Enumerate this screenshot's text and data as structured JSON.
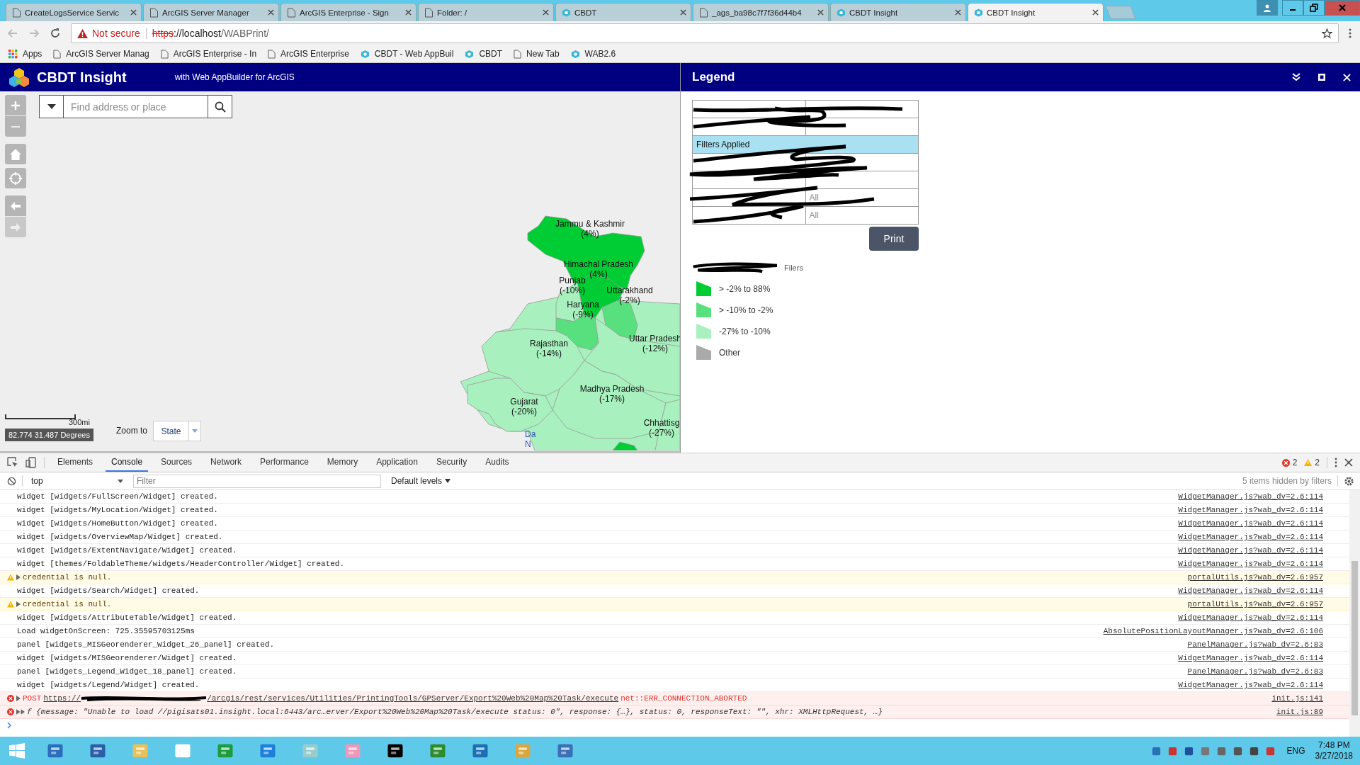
{
  "browser": {
    "tabs": [
      {
        "title": "CreateLogsService Servic",
        "kind": "page",
        "selected": false
      },
      {
        "title": "ArcGIS Server Manager",
        "kind": "page",
        "selected": false
      },
      {
        "title": "ArcGIS Enterprise - Sign",
        "kind": "page",
        "selected": false
      },
      {
        "title": "Folder: /",
        "kind": "page",
        "selected": false
      },
      {
        "title": "CBDT",
        "kind": "app",
        "selected": false
      },
      {
        "title": "_ags_ba98c7f7f36d44b4",
        "kind": "page",
        "selected": false
      },
      {
        "title": "CBDT Insight",
        "kind": "app",
        "selected": false
      },
      {
        "title": "CBDT Insight",
        "kind": "app",
        "selected": true
      }
    ],
    "security": "Not secure",
    "url_scheme": "https",
    "url_host": "://localhost",
    "url_path": "/WABPrint/",
    "bookmarks": [
      {
        "label": "Apps",
        "kind": "apps"
      },
      {
        "label": "ArcGIS Server Manag",
        "kind": "page"
      },
      {
        "label": "ArcGIS Enterprise - In",
        "kind": "page"
      },
      {
        "label": "ArcGIS Enterprise",
        "kind": "page"
      },
      {
        "label": "CBDT - Web AppBuil",
        "kind": "app"
      },
      {
        "label": "CBDT",
        "kind": "app"
      },
      {
        "label": "New Tab",
        "kind": "page"
      },
      {
        "label": "WAB2.6",
        "kind": "app"
      }
    ]
  },
  "app": {
    "title": "CBDT Insight",
    "subtitle": "with Web AppBuilder for ArcGIS",
    "search": {
      "placeholder": "Find address or place"
    },
    "scale": "300mi",
    "coordinates": "82.774 31.487 Degrees",
    "zoom_to_label": "Zoom to",
    "zoom_to_value": "State",
    "regions": [
      {
        "color": "#a8f0be"
      },
      {
        "color": "#00cc33",
        "label": "Jammu & Kashmir",
        "value": "(4%)"
      },
      {
        "color": "#00cc33",
        "label": "Himachal Pradesh",
        "value": "(4%)"
      },
      {
        "color": "#a8f0be",
        "label": "Punjab",
        "value": "(-10%)"
      },
      {
        "color": "#58e07f",
        "label": "Uttarakhand",
        "value": "(-2%)"
      },
      {
        "color": "#58e07f",
        "label": "Haryana",
        "value": "(-9%)"
      },
      {
        "color": "#a8f0be",
        "label": "Rajasthan",
        "value": "(-14%)"
      },
      {
        "color": "#a8f0be",
        "label": "Uttar Pradesh",
        "value": "(-12%)"
      },
      {
        "color": "#a8f0be",
        "label": "Madhya Pradesh",
        "value": "(-17%)"
      },
      {
        "color": "#a8f0be",
        "label": "Gujarat",
        "value": "(-20%)"
      },
      {
        "color": "#a8f0be",
        "label": "Chhattisg",
        "value": "(-27%)"
      },
      {
        "color": "#00cc33"
      }
    ],
    "map_labels": [
      "Da",
      "N"
    ]
  },
  "legend": {
    "title": "Legend",
    "table": [
      {
        "kind": "redacted"
      },
      {
        "kind": "redacted"
      },
      {
        "kind": "header",
        "label": "Filters Applied"
      },
      {
        "kind": "redacted"
      },
      {
        "kind": "redacted"
      },
      {
        "kind": "row",
        "value": "All"
      },
      {
        "kind": "row",
        "value": "All"
      }
    ],
    "print_button": "Print",
    "layer_title": "Filers",
    "classes": [
      {
        "label": "> -2% to 88%",
        "color": "#00cc33"
      },
      {
        "label": "> -10% to -2%",
        "color": "#58e07f"
      },
      {
        "label": "-27% to -10%",
        "color": "#a8f0be"
      },
      {
        "label": "Other",
        "color": "#aaaaaa"
      }
    ]
  },
  "devtools": {
    "tabs": [
      {
        "label": "Elements",
        "selected": false
      },
      {
        "label": "Console",
        "selected": true
      },
      {
        "label": "Sources",
        "selected": false
      },
      {
        "label": "Network",
        "selected": false
      },
      {
        "label": "Performance",
        "selected": false
      },
      {
        "label": "Memory",
        "selected": false
      },
      {
        "label": "Application",
        "selected": false
      },
      {
        "label": "Security",
        "selected": false
      },
      {
        "label": "Audits",
        "selected": false
      }
    ],
    "error_count": "2",
    "warning_count": "2",
    "context": "top",
    "filter": {
      "placeholder": "Filter"
    },
    "levels": "Default levels",
    "hidden_note": "5 items hidden by filters",
    "messages": [
      {
        "kind": "log",
        "text": "widget [widgets/FullScreen/Widget] created.",
        "source": "WidgetManager.js?wab_dv=2.6:114"
      },
      {
        "kind": "log",
        "text": "widget [widgets/MyLocation/Widget] created.",
        "source": "WidgetManager.js?wab_dv=2.6:114"
      },
      {
        "kind": "log",
        "text": "widget [widgets/HomeButton/Widget] created.",
        "source": "WidgetManager.js?wab_dv=2.6:114"
      },
      {
        "kind": "log",
        "text": "widget [widgets/OverviewMap/Widget] created.",
        "source": "WidgetManager.js?wab_dv=2.6:114"
      },
      {
        "kind": "log",
        "text": "widget [widgets/ExtentNavigate/Widget] created.",
        "source": "WidgetManager.js?wab_dv=2.6:114"
      },
      {
        "kind": "log",
        "text": "widget [themes/FoldableTheme/widgets/HeaderController/Widget] created.",
        "source": "WidgetManager.js?wab_dv=2.6:114"
      },
      {
        "kind": "warning",
        "text": "credential is null.",
        "source": "portalUtils.js?wab_dv=2.6:957"
      },
      {
        "kind": "log",
        "text": "widget [widgets/Search/Widget] created.",
        "source": "WidgetManager.js?wab_dv=2.6:114"
      },
      {
        "kind": "warning",
        "text": "credential is null.",
        "source": "portalUtils.js?wab_dv=2.6:957"
      },
      {
        "kind": "log",
        "text": "widget [widgets/AttributeTable/Widget] created.",
        "source": "WidgetManager.js?wab_dv=2.6:114"
      },
      {
        "kind": "log",
        "text": "Load widgetOnScreen: 725.35595703125ms",
        "source": "AbsolutePositionLayoutManager.js?wab_dv=2.6:106"
      },
      {
        "kind": "log",
        "text": "panel [widgets_MISGeorenderer_Widget_26_panel] created.",
        "source": "PanelManager.js?wab_dv=2.6:83"
      },
      {
        "kind": "log",
        "text": "widget [widgets/MISGeorenderer/Widget] created.",
        "source": "WidgetManager.js?wab_dv=2.6:114"
      },
      {
        "kind": "log",
        "text": "panel [widgets_Legend_Widget_18_panel] created.",
        "source": "PanelManager.js?wab_dv=2.6:83"
      },
      {
        "kind": "log",
        "text": "widget [widgets/Legend/Widget] created.",
        "source": "WidgetManager.js?wab_dv=2.6:114"
      },
      {
        "kind": "request_error",
        "method": "POST",
        "url_start": "https://",
        "url_end": "/arcgis/rest/services/Utilities/PrintingTools/GPServer/Export%20Web%20Map%20Task/execute",
        "status": "net::ERR_CONNECTION_ABORTED",
        "source": "init.js:141"
      },
      {
        "kind": "error",
        "text": "f {message: \"Unable to load //pigisats01.insight.local:6443/arc…erver/Export%20Web%20Map%20Task/execute status: 0\", response: {…}, status: 0, responseText: \"\", xhr: XMLHttpRequest, …}",
        "source": "init.js:89"
      }
    ]
  },
  "taskbar": {
    "language": "ENG",
    "time": "7:48 PM",
    "date": "3/27/2018"
  }
}
